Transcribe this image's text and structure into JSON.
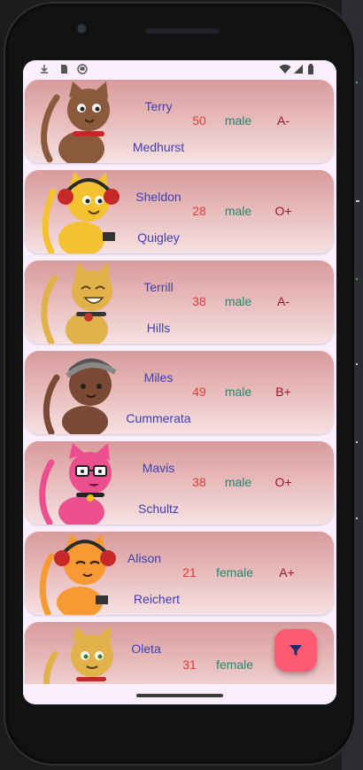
{
  "statusbar": {
    "left_icons": [
      "download-icon",
      "sd-card-icon",
      "shield-icon"
    ],
    "right_icons": [
      "wifi-icon",
      "signal-icon",
      "battery-icon"
    ]
  },
  "people": [
    {
      "first_name": "Terry",
      "last_name": "Medhurst",
      "age": "50",
      "gender": "male",
      "blood_group": "A-",
      "avatar": "brown-cat-avatar",
      "fur": "#8b5a3c"
    },
    {
      "first_name": "Sheldon",
      "last_name": "Quigley",
      "age": "28",
      "gender": "male",
      "blood_group": "O+",
      "avatar": "yellow-cat-headphones-avatar",
      "fur": "#f2c230"
    },
    {
      "first_name": "Terrill",
      "last_name": "Hills",
      "age": "38",
      "gender": "male",
      "blood_group": "A-",
      "avatar": "golden-cat-avatar",
      "fur": "#e2b24a"
    },
    {
      "first_name": "Miles",
      "last_name": "Cummerata",
      "age": "49",
      "gender": "male",
      "blood_group": "B+",
      "avatar": "brown-cat-bandana-avatar",
      "fur": "#7a4a34"
    },
    {
      "first_name": "Mavis",
      "last_name": "Schultz",
      "age": "38",
      "gender": "male",
      "blood_group": "O+",
      "avatar": "pink-cat-glasses-avatar",
      "fur": "#ec4f8e"
    },
    {
      "first_name": "Alison",
      "last_name": "Reichert",
      "age": "21",
      "gender": "female",
      "blood_group": "A+",
      "avatar": "orange-cat-headphones-avatar",
      "fur": "#f79a33"
    },
    {
      "first_name": "Oleta",
      "last_name": "",
      "age": "31",
      "gender": "female",
      "blood_group": "",
      "avatar": "golden-cat-avatar",
      "fur": "#e2b24a"
    }
  ],
  "fab": {
    "icon": "filter-icon"
  },
  "colors": {
    "card_top": "#d89b9b",
    "card_bottom": "#f6e1e3",
    "name": "#3d3fb2",
    "age": "#e53935",
    "gender": "#1e8a6f",
    "blood_group": "#a01629",
    "fab": "#ff5a73"
  }
}
